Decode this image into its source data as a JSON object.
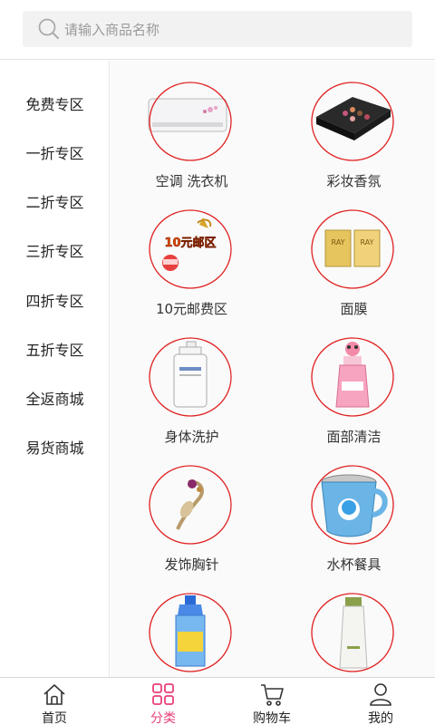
{
  "search": {
    "placeholder": "请输入商品名称"
  },
  "sidebar": {
    "items": [
      {
        "label": "免费专区"
      },
      {
        "label": "一折专区"
      },
      {
        "label": "二折专区"
      },
      {
        "label": "三折专区"
      },
      {
        "label": "四折专区"
      },
      {
        "label": "五折专区"
      },
      {
        "label": "全返商城"
      },
      {
        "label": "易货商城"
      }
    ]
  },
  "categories": [
    {
      "label": "空调 洗衣机",
      "icon": "air-conditioner-image"
    },
    {
      "label": "彩妆香氛",
      "icon": "makeup-palette-image"
    },
    {
      "label": "10元邮费区",
      "icon": "postage-badge-image",
      "badge_text": "10元邮区"
    },
    {
      "label": "面膜",
      "icon": "face-mask-box-image",
      "box_text": "RAY"
    },
    {
      "label": "身体洗护",
      "icon": "body-lotion-bottle-image"
    },
    {
      "label": "面部清洁",
      "icon": "cleanser-bottle-image"
    },
    {
      "label": "发饰胸针",
      "icon": "brooch-image"
    },
    {
      "label": "水杯餐具",
      "icon": "cup-image"
    },
    {
      "label": "",
      "icon": "blue-bottle-image"
    },
    {
      "label": "",
      "icon": "white-tube-image"
    }
  ],
  "tabbar": {
    "tabs": [
      {
        "label": "首页",
        "icon": "home-icon"
      },
      {
        "label": "分类",
        "icon": "category-grid-icon",
        "active": true
      },
      {
        "label": "购物车",
        "icon": "cart-icon"
      },
      {
        "label": "我的",
        "icon": "user-icon"
      }
    ]
  },
  "colors": {
    "accent": "#e8407a",
    "circle": "#e02020",
    "search_bg": "#f2f2f2"
  }
}
